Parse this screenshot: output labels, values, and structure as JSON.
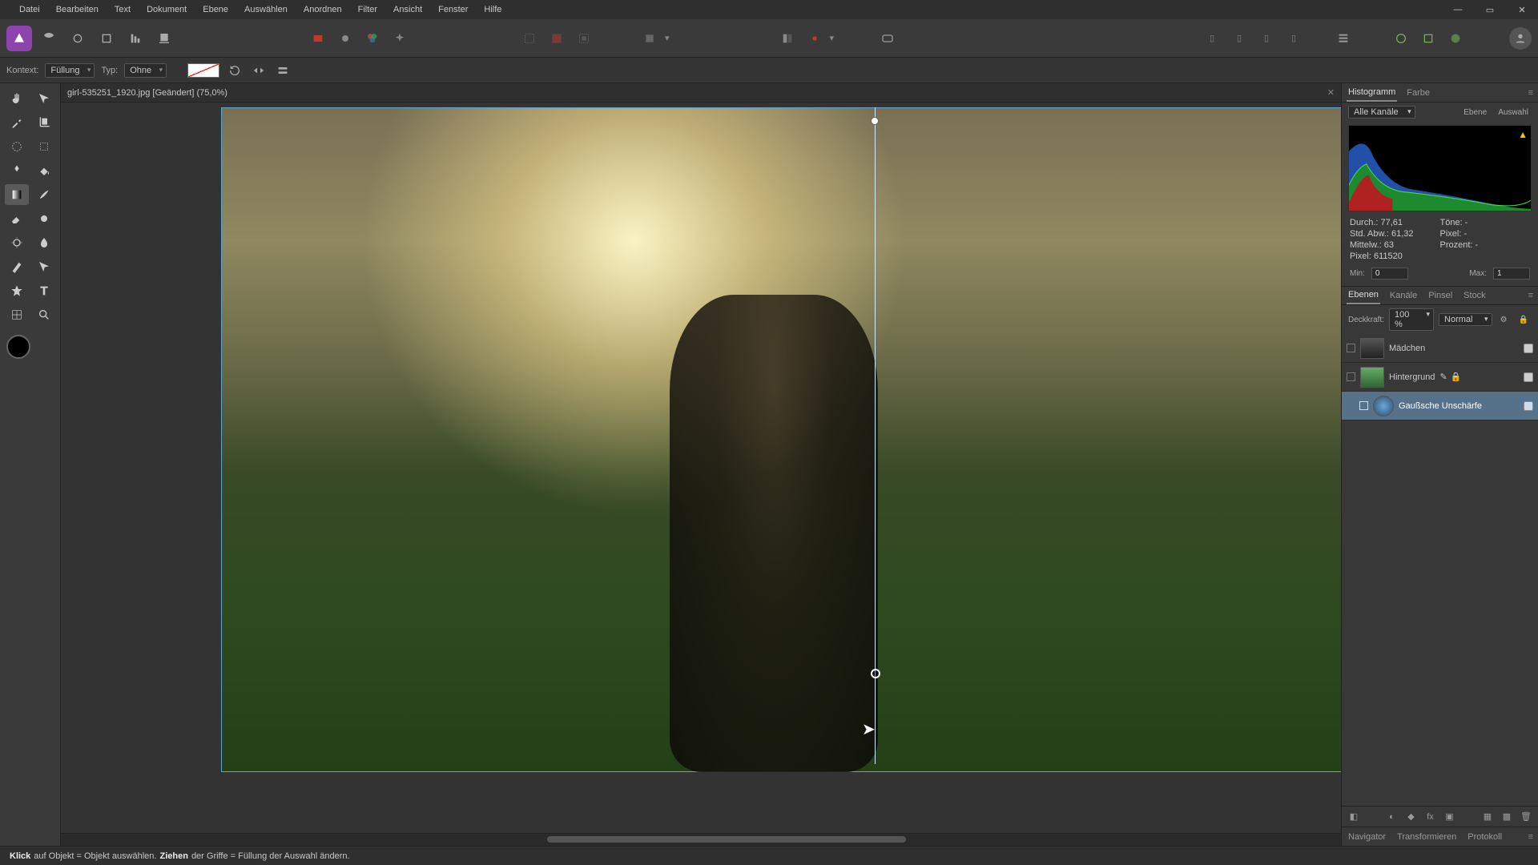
{
  "menu": {
    "items": [
      "Datei",
      "Bearbeiten",
      "Text",
      "Dokument",
      "Ebene",
      "Auswählen",
      "Anordnen",
      "Filter",
      "Ansicht",
      "Fenster",
      "Hilfe"
    ]
  },
  "contextbar": {
    "label": "Kontext:",
    "fill_select": "Füllung",
    "type_label": "Typ:",
    "type_select": "Ohne"
  },
  "document": {
    "tab_title": "girl-535251_1920.jpg [Geändert] (75,0%)"
  },
  "histogram_panel": {
    "tabs": [
      "Histogramm",
      "Farbe"
    ],
    "channel": "Alle Kanäle",
    "btn_layer": "Ebene",
    "btn_selection": "Auswahl",
    "stats": {
      "durch": "Durch.: 77,61",
      "sabw": "Std. Abw.: 61,32",
      "mittelw": "Mittelw.: 63",
      "pixel": "Pixel: 611520",
      "toene": "Töne: -",
      "pixel2": "Pixel: -",
      "prozent": "Prozent: -"
    },
    "min_label": "Min:",
    "min_val": "0",
    "max_label": "Max:",
    "max_val": "1"
  },
  "layers_panel": {
    "tabs": [
      "Ebenen",
      "Kanäle",
      "Pinsel",
      "Stock"
    ],
    "opacity_label": "Deckkraft:",
    "opacity_value": "100 %",
    "blend_mode": "Normal",
    "layers": [
      {
        "name": "Mädchen"
      },
      {
        "name": "Hintergrund"
      },
      {
        "name": "Gaußsche Unschärfe"
      }
    ]
  },
  "nav_panel": {
    "tabs": [
      "Navigator",
      "Transformieren",
      "Protokoll"
    ]
  },
  "statusbar": {
    "s1": "Klick",
    "s2": " auf Objekt = Objekt auswählen. ",
    "s3": "Ziehen",
    "s4": " der Griffe = Füllung der Auswahl ändern."
  },
  "icons": {
    "minimize": "—",
    "maximize": "▭",
    "close": "✕",
    "chevron": "▾",
    "warn": "▲",
    "menu": "≡",
    "lock": "🔒",
    "eye": "👁",
    "gear": "⚙",
    "trash": "🗑"
  }
}
